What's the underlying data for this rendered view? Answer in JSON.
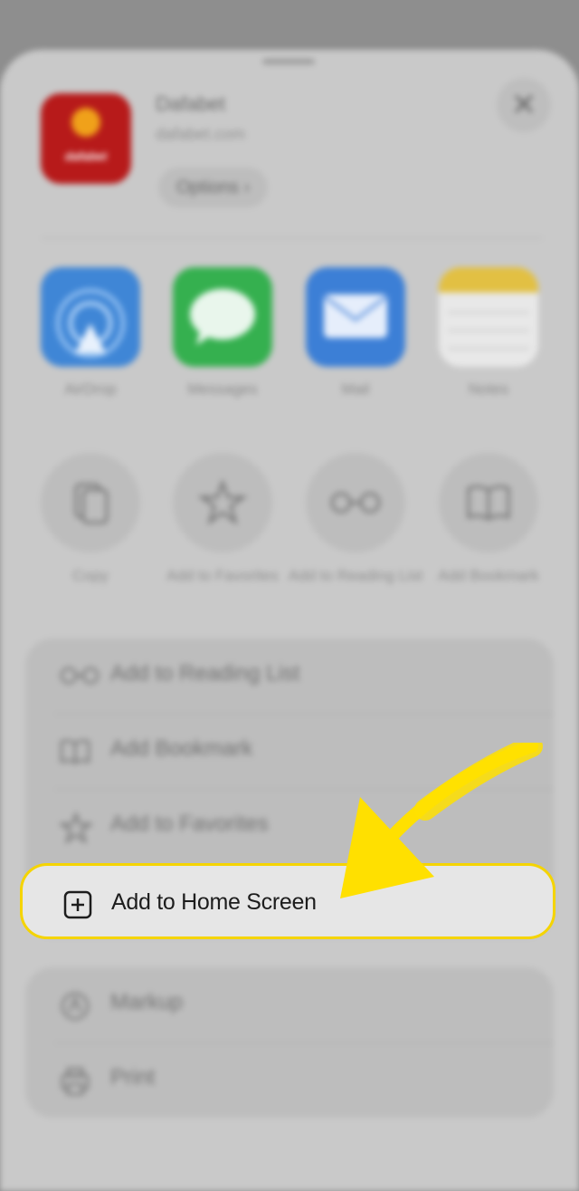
{
  "site": {
    "name": "Dafabet",
    "url": "dafabet.com",
    "options_label": "Options",
    "icon_text": "dafabet"
  },
  "close_label": "✕",
  "share_targets": [
    {
      "label": "AirDrop"
    },
    {
      "label": "Messages"
    },
    {
      "label": "Mail"
    },
    {
      "label": "Notes"
    }
  ],
  "quick_actions": [
    {
      "label": "Copy"
    },
    {
      "label": "Add to Favorites"
    },
    {
      "label": "Add to Reading List"
    },
    {
      "label": "Add Bookmark"
    }
  ],
  "action_list": [
    {
      "label": "Add to Reading List",
      "icon": "glasses-icon"
    },
    {
      "label": "Add Bookmark",
      "icon": "book-icon"
    },
    {
      "label": "Add to Favorites",
      "icon": "star-icon"
    }
  ],
  "highlighted_action": {
    "label": "Add to Home Screen",
    "icon": "plus-square-icon"
  },
  "more_actions": [
    {
      "label": "Markup",
      "icon": "markup-icon"
    },
    {
      "label": "Print",
      "icon": "printer-icon"
    }
  ],
  "colors": {
    "highlight_border": "#f5d400",
    "arrow": "#ffe000",
    "app_icon_bg": "#b71a1a"
  }
}
